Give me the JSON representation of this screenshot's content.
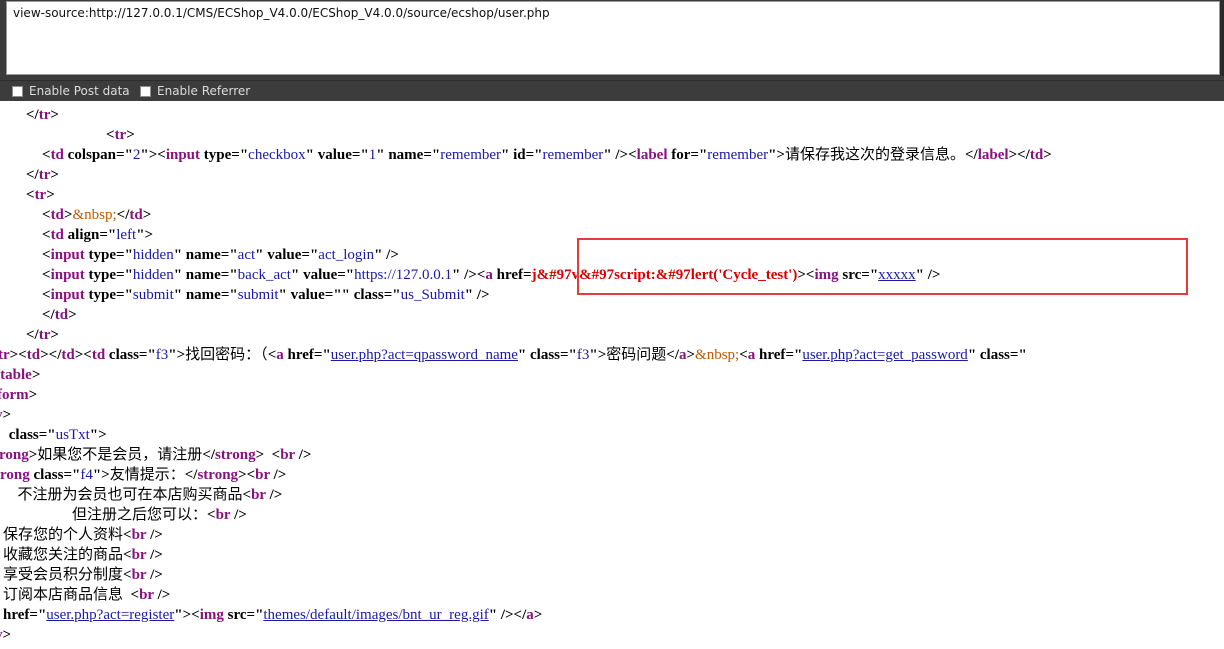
{
  "address_bar": {
    "url": "view-source:http://127.0.0.1/CMS/ECShop_V4.0.0/ECShop_V4.0.0/source/ecshop/user.php"
  },
  "options": [
    {
      "label": "Enable Post data",
      "checked": false
    },
    {
      "label": "Enable Referrer",
      "checked": false
    }
  ],
  "source_lines": [
    [
      [
        "bk",
        "</"
      ],
      [
        "tag",
        "tr"
      ],
      [
        "bk",
        ">"
      ]
    ],
    [
      [
        "bk",
        "<"
      ],
      [
        "tag",
        "tr"
      ],
      [
        "bk",
        ">"
      ]
    ],
    [
      [
        "bk",
        "<"
      ],
      [
        "tag",
        "td"
      ],
      [
        "an",
        " colspan"
      ],
      [
        "bk",
        "=\""
      ],
      [
        "av",
        "2"
      ],
      [
        "bk",
        "\">"
      ],
      [
        "bk",
        "<"
      ],
      [
        "tag",
        "input"
      ],
      [
        "an",
        " type"
      ],
      [
        "bk",
        "=\""
      ],
      [
        "av",
        "checkbox"
      ],
      [
        "bk",
        "\""
      ],
      [
        "an",
        " value"
      ],
      [
        "bk",
        "=\""
      ],
      [
        "av",
        "1"
      ],
      [
        "bk",
        "\""
      ],
      [
        "an",
        " name"
      ],
      [
        "bk",
        "=\""
      ],
      [
        "av",
        "remember"
      ],
      [
        "bk",
        "\""
      ],
      [
        "an",
        " id"
      ],
      [
        "bk",
        "=\""
      ],
      [
        "av",
        "remember"
      ],
      [
        "bk",
        "\" />"
      ],
      [
        "bk",
        "<"
      ],
      [
        "tag",
        "label"
      ],
      [
        "an",
        " for"
      ],
      [
        "bk",
        "=\""
      ],
      [
        "av",
        "remember"
      ],
      [
        "bk",
        "\">"
      ],
      [
        "txt",
        "请保存我这次的登录信息。"
      ],
      [
        "bk",
        "</"
      ],
      [
        "tag",
        "label"
      ],
      [
        "bk",
        "></"
      ],
      [
        "tag",
        "td"
      ],
      [
        "bk",
        ">"
      ]
    ],
    [
      [
        "bk",
        "</"
      ],
      [
        "tag",
        "tr"
      ],
      [
        "bk",
        ">"
      ]
    ],
    [
      [
        "bk",
        "<"
      ],
      [
        "tag",
        "tr"
      ],
      [
        "bk",
        ">"
      ]
    ],
    [
      [
        "bk",
        "<"
      ],
      [
        "tag",
        "td"
      ],
      [
        "bk",
        ">"
      ],
      [
        "ent",
        "&nbsp;"
      ],
      [
        "bk",
        "</"
      ],
      [
        "tag",
        "td"
      ],
      [
        "bk",
        ">"
      ]
    ],
    [
      [
        "bk",
        "<"
      ],
      [
        "tag",
        "td"
      ],
      [
        "an",
        " align"
      ],
      [
        "bk",
        "=\""
      ],
      [
        "av",
        "left"
      ],
      [
        "bk",
        "\">"
      ]
    ],
    [
      [
        "bk",
        "<"
      ],
      [
        "tag",
        "input"
      ],
      [
        "an",
        " type"
      ],
      [
        "bk",
        "=\""
      ],
      [
        "av",
        "hidden"
      ],
      [
        "bk",
        "\""
      ],
      [
        "an",
        " name"
      ],
      [
        "bk",
        "=\""
      ],
      [
        "av",
        "act"
      ],
      [
        "bk",
        "\""
      ],
      [
        "an",
        " value"
      ],
      [
        "bk",
        "=\""
      ],
      [
        "av",
        "act_login"
      ],
      [
        "bk",
        "\" />"
      ]
    ],
    [
      [
        "bk",
        "<"
      ],
      [
        "tag",
        "input"
      ],
      [
        "an",
        " type"
      ],
      [
        "bk",
        "=\""
      ],
      [
        "av",
        "hidden"
      ],
      [
        "bk",
        "\""
      ],
      [
        "an",
        " name"
      ],
      [
        "bk",
        "=\""
      ],
      [
        "av",
        "back_act"
      ],
      [
        "bk",
        "\""
      ],
      [
        "an",
        " value"
      ],
      [
        "bk",
        "=\""
      ],
      [
        "av",
        "https://127.0.0.1"
      ],
      [
        "bk",
        "\" />"
      ],
      [
        "bk",
        "<"
      ],
      [
        "tag",
        "a"
      ],
      [
        "an",
        " href"
      ],
      [
        "bk",
        "="
      ],
      [
        "red",
        "j&#97v&#97script:&#97lert('Cycle_test')"
      ],
      [
        "bk",
        ">"
      ],
      [
        "bk",
        "<"
      ],
      [
        "tag",
        "img"
      ],
      [
        "an",
        " src"
      ],
      [
        "bk",
        "=\""
      ],
      [
        "lnk",
        "xxxxx"
      ],
      [
        "bk",
        "\" />"
      ]
    ],
    [
      [
        "bk",
        "<"
      ],
      [
        "tag",
        "input"
      ],
      [
        "an",
        " type"
      ],
      [
        "bk",
        "=\""
      ],
      [
        "av",
        "submit"
      ],
      [
        "bk",
        "\""
      ],
      [
        "an",
        " name"
      ],
      [
        "bk",
        "=\""
      ],
      [
        "av",
        "submit"
      ],
      [
        "bk",
        "\""
      ],
      [
        "an",
        " value"
      ],
      [
        "bk",
        "=\"\""
      ],
      [
        "an",
        " class"
      ],
      [
        "bk",
        "=\""
      ],
      [
        "av",
        "us_Submit"
      ],
      [
        "bk",
        "\" />"
      ]
    ],
    [
      [
        "bk",
        "</"
      ],
      [
        "tag",
        "td"
      ],
      [
        "bk",
        ">"
      ]
    ],
    [
      [
        "bk",
        "</"
      ],
      [
        "tag",
        "tr"
      ],
      [
        "bk",
        ">"
      ]
    ],
    [
      [
        "tag",
        "tr"
      ],
      [
        "bk",
        "><"
      ],
      [
        "tag",
        "td"
      ],
      [
        "bk",
        "></"
      ],
      [
        "tag",
        "td"
      ],
      [
        "bk",
        "><"
      ],
      [
        "tag",
        "td"
      ],
      [
        "an",
        " class"
      ],
      [
        "bk",
        "=\""
      ],
      [
        "av",
        "f3"
      ],
      [
        "bk",
        "\">"
      ],
      [
        "txt",
        "找回密码：（"
      ],
      [
        "bk",
        "<"
      ],
      [
        "tag",
        "a"
      ],
      [
        "an",
        " href"
      ],
      [
        "bk",
        "=\""
      ],
      [
        "lnk",
        "user.php?act=qpassword_name"
      ],
      [
        "bk",
        "\""
      ],
      [
        "an",
        " class"
      ],
      [
        "bk",
        "=\""
      ],
      [
        "av",
        "f3"
      ],
      [
        "bk",
        "\">"
      ],
      [
        "txt",
        "密码问题"
      ],
      [
        "bk",
        "</"
      ],
      [
        "tag",
        "a"
      ],
      [
        "bk",
        ">"
      ],
      [
        "ent",
        "&nbsp;"
      ],
      [
        "bk",
        "<"
      ],
      [
        "tag",
        "a"
      ],
      [
        "an",
        " href"
      ],
      [
        "bk",
        "=\""
      ],
      [
        "lnk",
        "user.php?act=get_password"
      ],
      [
        "bk",
        "\""
      ],
      [
        "an",
        " class"
      ],
      [
        "bk",
        "=\""
      ]
    ],
    [
      [
        "bk",
        "/"
      ],
      [
        "tag",
        "table"
      ],
      [
        "bk",
        ">"
      ]
    ],
    [
      [
        "tag",
        "form"
      ],
      [
        "bk",
        ">"
      ]
    ],
    [
      [
        "tag",
        "v"
      ],
      [
        "bk",
        ">"
      ]
    ],
    [
      [
        "an",
        " class"
      ],
      [
        "bk",
        "=\""
      ],
      [
        "av",
        "usTxt"
      ],
      [
        "bk",
        "\">"
      ]
    ],
    [
      [
        "tag",
        "trong"
      ],
      [
        "bk",
        ">"
      ],
      [
        "txt",
        "如果您不是会员，请注册"
      ],
      [
        "bk",
        "</"
      ],
      [
        "tag",
        "strong"
      ],
      [
        "bk",
        ">  <"
      ],
      [
        "tag",
        "br"
      ],
      [
        "bk",
        " />"
      ]
    ],
    [
      [
        "tag",
        "trong"
      ],
      [
        "an",
        " class"
      ],
      [
        "bk",
        "=\""
      ],
      [
        "av",
        "f4"
      ],
      [
        "bk",
        "\">"
      ],
      [
        "txt",
        "友情提示："
      ],
      [
        "bk",
        "</"
      ],
      [
        "tag",
        "strong"
      ],
      [
        "bk",
        "><"
      ],
      [
        "tag",
        "br"
      ],
      [
        "bk",
        " />"
      ]
    ],
    [
      [
        "txt",
        "  不注册为会员也可在本店购买商品"
      ],
      [
        "bk",
        "<"
      ],
      [
        "tag",
        "br"
      ],
      [
        "bk",
        " />"
      ]
    ],
    [
      [
        "txt",
        "        但注册之后您可以："
      ],
      [
        "bk",
        "<"
      ],
      [
        "tag",
        "br"
      ],
      [
        "bk",
        " />"
      ]
    ],
    [
      [
        "txt",
        "保存您的个人资料"
      ],
      [
        "bk",
        "<"
      ],
      [
        "tag",
        "br"
      ],
      [
        "bk",
        " />"
      ]
    ],
    [
      [
        "txt",
        "收藏您关注的商品"
      ],
      [
        "bk",
        "<"
      ],
      [
        "tag",
        "br"
      ],
      [
        "bk",
        " />"
      ]
    ],
    [
      [
        "txt",
        "享受会员积分制度"
      ],
      [
        "bk",
        "<"
      ],
      [
        "tag",
        "br"
      ],
      [
        "bk",
        " />"
      ]
    ],
    [
      [
        "txt",
        "订阅本店商品信息  "
      ],
      [
        "bk",
        "<"
      ],
      [
        "tag",
        "br"
      ],
      [
        "bk",
        " />"
      ]
    ],
    [
      [
        "an",
        "href"
      ],
      [
        "bk",
        "=\""
      ],
      [
        "lnk",
        "user.php?act=register"
      ],
      [
        "bk",
        "\"><"
      ],
      [
        "tag",
        "img"
      ],
      [
        "an",
        " src"
      ],
      [
        "bk",
        "=\""
      ],
      [
        "lnk",
        "themes/default/images/bnt_ur_reg.gif"
      ],
      [
        "bk",
        "\" /></"
      ],
      [
        "tag",
        "a"
      ],
      [
        "bk",
        ">"
      ]
    ],
    [
      [
        "tag",
        "v"
      ],
      [
        "bk",
        ">"
      ]
    ]
  ]
}
